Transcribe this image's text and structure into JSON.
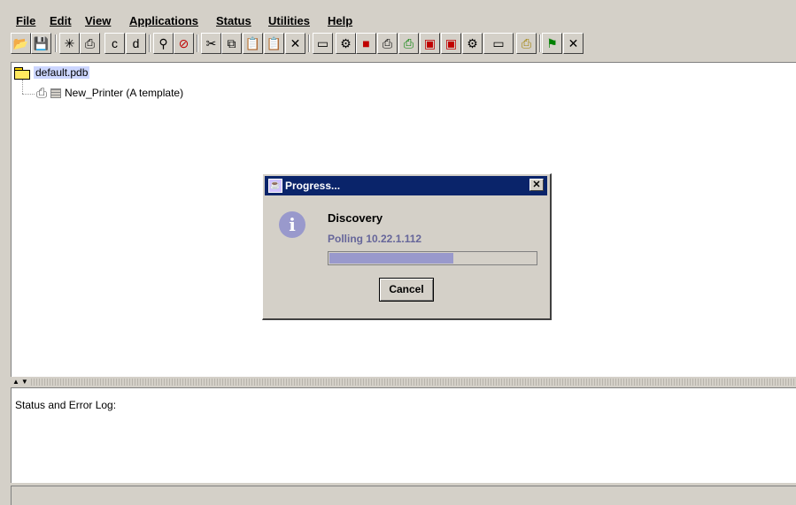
{
  "menu": [
    "File",
    "Edit",
    "View",
    "Applications",
    "Status",
    "Utilities",
    "Help"
  ],
  "menu_underline_index": [
    0,
    0,
    0,
    0,
    0,
    0,
    0
  ],
  "toolbar": {
    "buttons": [
      {
        "icon": "open-folder-icon",
        "glyph": "📂"
      },
      {
        "icon": "save-icon",
        "glyph": "💾"
      },
      {
        "icon": "new-printer-icon",
        "glyph": "✳"
      },
      {
        "icon": "printer-add-icon",
        "glyph": "⎙"
      },
      {
        "icon": "printer-c-icon",
        "glyph": "c"
      },
      {
        "icon": "printer-d-icon",
        "glyph": "d"
      },
      {
        "icon": "search-icon",
        "glyph": "⚲"
      },
      {
        "icon": "stop-icon",
        "glyph": "⊘"
      },
      {
        "icon": "cut-icon",
        "glyph": "✂"
      },
      {
        "icon": "copy-icon",
        "glyph": "⧉"
      },
      {
        "icon": "paste-icon",
        "glyph": "📋"
      },
      {
        "icon": "paste-special-icon",
        "glyph": "📋"
      },
      {
        "icon": "delete-icon",
        "glyph": "✕"
      },
      {
        "icon": "card-icon",
        "glyph": "▭"
      },
      {
        "icon": "printer-gear-icon",
        "glyph": "⚙"
      },
      {
        "icon": "red-square-icon",
        "glyph": "■"
      },
      {
        "icon": "printer-tray-icon",
        "glyph": "⎙"
      },
      {
        "icon": "printer-green-icon",
        "glyph": "⎙"
      },
      {
        "icon": "red-device-icon",
        "glyph": "▣"
      },
      {
        "icon": "red-device-2-icon",
        "glyph": "▣"
      },
      {
        "icon": "gear-printer-icon",
        "glyph": "⚙"
      },
      {
        "icon": "tape-icon",
        "glyph": "▭"
      },
      {
        "icon": "printer-yellow-icon",
        "glyph": "⎙"
      },
      {
        "icon": "flag-icon",
        "glyph": "⚑"
      },
      {
        "icon": "telescope-icon",
        "glyph": "✕"
      }
    ]
  },
  "tree": {
    "root_label": "default.pdb",
    "child_label": "New_Printer (A template)"
  },
  "log": {
    "label": "Status and Error Log:"
  },
  "dialog": {
    "title": "Progress...",
    "close_glyph": "✕",
    "info_glyph": "i",
    "heading": "Discovery",
    "status": "Polling 10.22.1.112",
    "progress": 0.6,
    "cancel_label": "Cancel"
  },
  "colors": {
    "titlebar": "#0a246a",
    "progress_fill": "#9999cc",
    "selection": "#ccd6ff"
  }
}
